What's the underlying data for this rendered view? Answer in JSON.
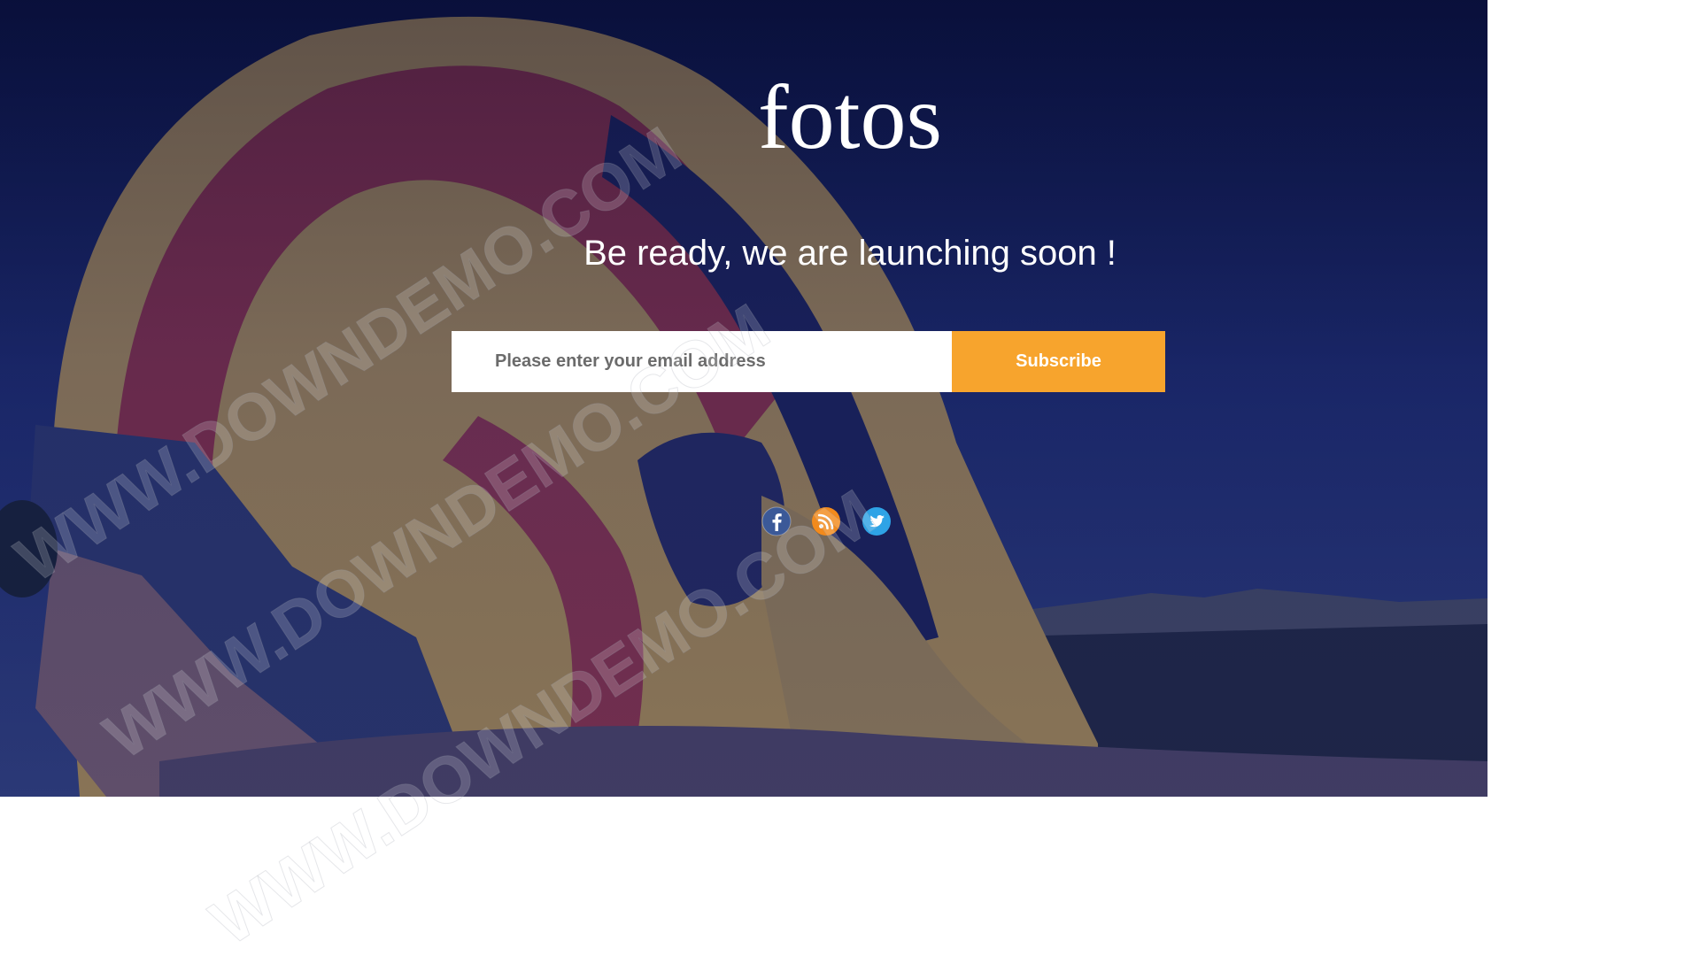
{
  "brand": {
    "logo_text": "fotos"
  },
  "hero": {
    "tagline": "Be ready, we are launching soon !",
    "background_image": "hot-air-balloon-at-dusk"
  },
  "subscribe": {
    "email_placeholder": "Please enter your email address",
    "button_label": "Subscribe"
  },
  "social": [
    {
      "name": "facebook-icon",
      "color": "#3b5998"
    },
    {
      "name": "rss-icon",
      "color": "#f28a1c"
    },
    {
      "name": "twitter-icon",
      "color": "#1da1f2"
    }
  ],
  "watermark": {
    "text": "WWW.DOWNDEMO.COM"
  },
  "colors": {
    "accent": "#f7a42d",
    "overlay": "#0f1950",
    "text": "#ffffff"
  }
}
